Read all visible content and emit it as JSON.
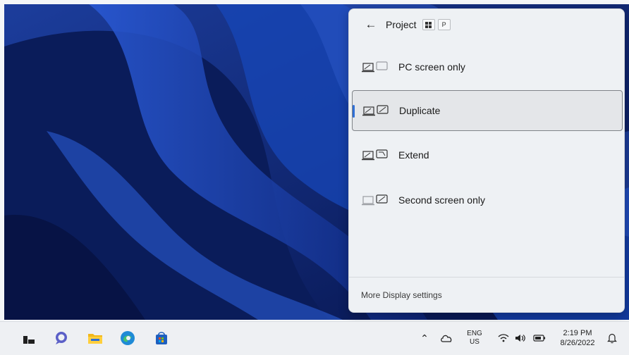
{
  "flyout": {
    "title": "Project",
    "shortcut_keys": [
      "⊞",
      "P"
    ],
    "options": [
      {
        "label": "PC screen only",
        "icon": "pc-screen-only-icon",
        "selected": false
      },
      {
        "label": "Duplicate",
        "icon": "duplicate-icon",
        "selected": true
      },
      {
        "label": "Extend",
        "icon": "extend-icon",
        "selected": false
      },
      {
        "label": "Second screen only",
        "icon": "second-screen-only-icon",
        "selected": false
      }
    ],
    "footer_link": "More Display settings"
  },
  "taskbar": {
    "apps": [
      "start-icon",
      "chat-icon",
      "file-explorer-icon",
      "edge-icon",
      "store-icon"
    ],
    "language": {
      "line1": "ENG",
      "line2": "US"
    },
    "clock": {
      "time": "2:19 PM",
      "date": "8/26/2022"
    }
  },
  "colors": {
    "accent": "#2f6fd6",
    "wallpaper": "#0b1f5c",
    "flyout_bg": "#eef1f4"
  }
}
